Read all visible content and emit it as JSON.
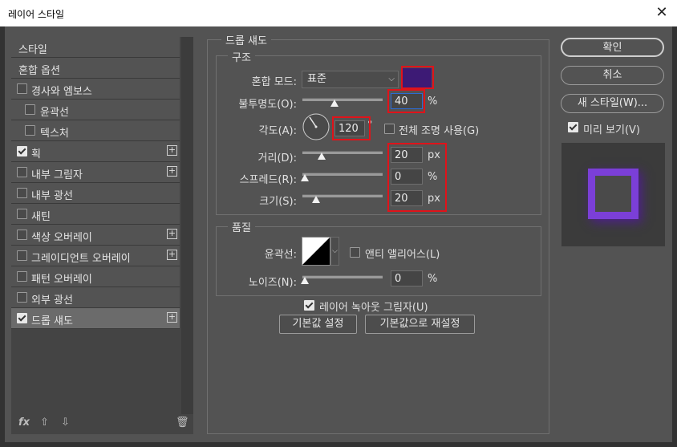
{
  "window": {
    "title": "레이어 스타일",
    "close_icon": "close-icon"
  },
  "sidebar": {
    "items": [
      {
        "label": "스타일",
        "checkbox": null,
        "plus": false,
        "indent": false,
        "selected": false
      },
      {
        "label": "혼합 옵션",
        "checkbox": null,
        "plus": false,
        "indent": false,
        "selected": false
      },
      {
        "label": "경사와 엠보스",
        "checkbox": false,
        "plus": false,
        "indent": false,
        "selected": false
      },
      {
        "label": "윤곽선",
        "checkbox": false,
        "plus": false,
        "indent": true,
        "selected": false
      },
      {
        "label": "텍스처",
        "checkbox": false,
        "plus": false,
        "indent": true,
        "selected": false
      },
      {
        "label": "획",
        "checkbox": true,
        "plus": true,
        "indent": false,
        "selected": false
      },
      {
        "label": "내부 그림자",
        "checkbox": false,
        "plus": true,
        "indent": false,
        "selected": false
      },
      {
        "label": "내부 광선",
        "checkbox": false,
        "plus": false,
        "indent": false,
        "selected": false
      },
      {
        "label": "새틴",
        "checkbox": false,
        "plus": false,
        "indent": false,
        "selected": false
      },
      {
        "label": "색상 오버레이",
        "checkbox": false,
        "plus": true,
        "indent": false,
        "selected": false
      },
      {
        "label": "그레이디언트 오버레이",
        "checkbox": false,
        "plus": true,
        "indent": false,
        "selected": false
      },
      {
        "label": "패턴 오버레이",
        "checkbox": false,
        "plus": false,
        "indent": false,
        "selected": false
      },
      {
        "label": "외부 광선",
        "checkbox": false,
        "plus": false,
        "indent": false,
        "selected": false
      },
      {
        "label": "드롭 섀도",
        "checkbox": true,
        "plus": true,
        "indent": false,
        "selected": true
      }
    ],
    "footer": {
      "fx": "fx",
      "up_icon": "arrow-up-icon",
      "down_icon": "arrow-down-icon",
      "trash_icon": "trash-icon"
    }
  },
  "drop_shadow": {
    "section_title": "드롭 섀도",
    "structure": {
      "title": "구조",
      "blend_mode_label": "혼합 모드:",
      "blend_mode_value": "표준",
      "shadow_color": "#3d1a75",
      "opacity_label": "불투명도(O):",
      "opacity_value": "40",
      "opacity_unit": "%",
      "opacity_percent": 40,
      "angle_label": "각도(A):",
      "angle_value": "120",
      "angle_unit": "°",
      "global_light_label": "전체 조명 사용(G)",
      "global_light_checked": false,
      "distance_label": "거리(D):",
      "distance_value": "20",
      "distance_unit": "px",
      "spread_label": "스프레드(R):",
      "spread_value": "0",
      "spread_unit": "%",
      "size_label": "크기(S):",
      "size_value": "20",
      "size_unit": "px"
    },
    "quality": {
      "title": "품질",
      "contour_label": "윤곽선:",
      "anti_alias_label": "앤티 앨리어스(L)",
      "anti_alias_checked": false,
      "noise_label": "노이즈(N):",
      "noise_value": "0",
      "noise_unit": "%"
    },
    "knockout_label": "레이어 녹아웃 그림자(U)",
    "knockout_checked": true,
    "make_default_label": "기본값 설정",
    "reset_default_label": "기본값으로 재설정"
  },
  "buttons": {
    "ok": "확인",
    "cancel": "취소",
    "new_style": "새 스타일(W)...",
    "preview_label": "미리 보기(V)",
    "preview_checked": true
  },
  "colors": {
    "preview_stroke": "#7b3fd8",
    "highlight": "#e0131a"
  }
}
